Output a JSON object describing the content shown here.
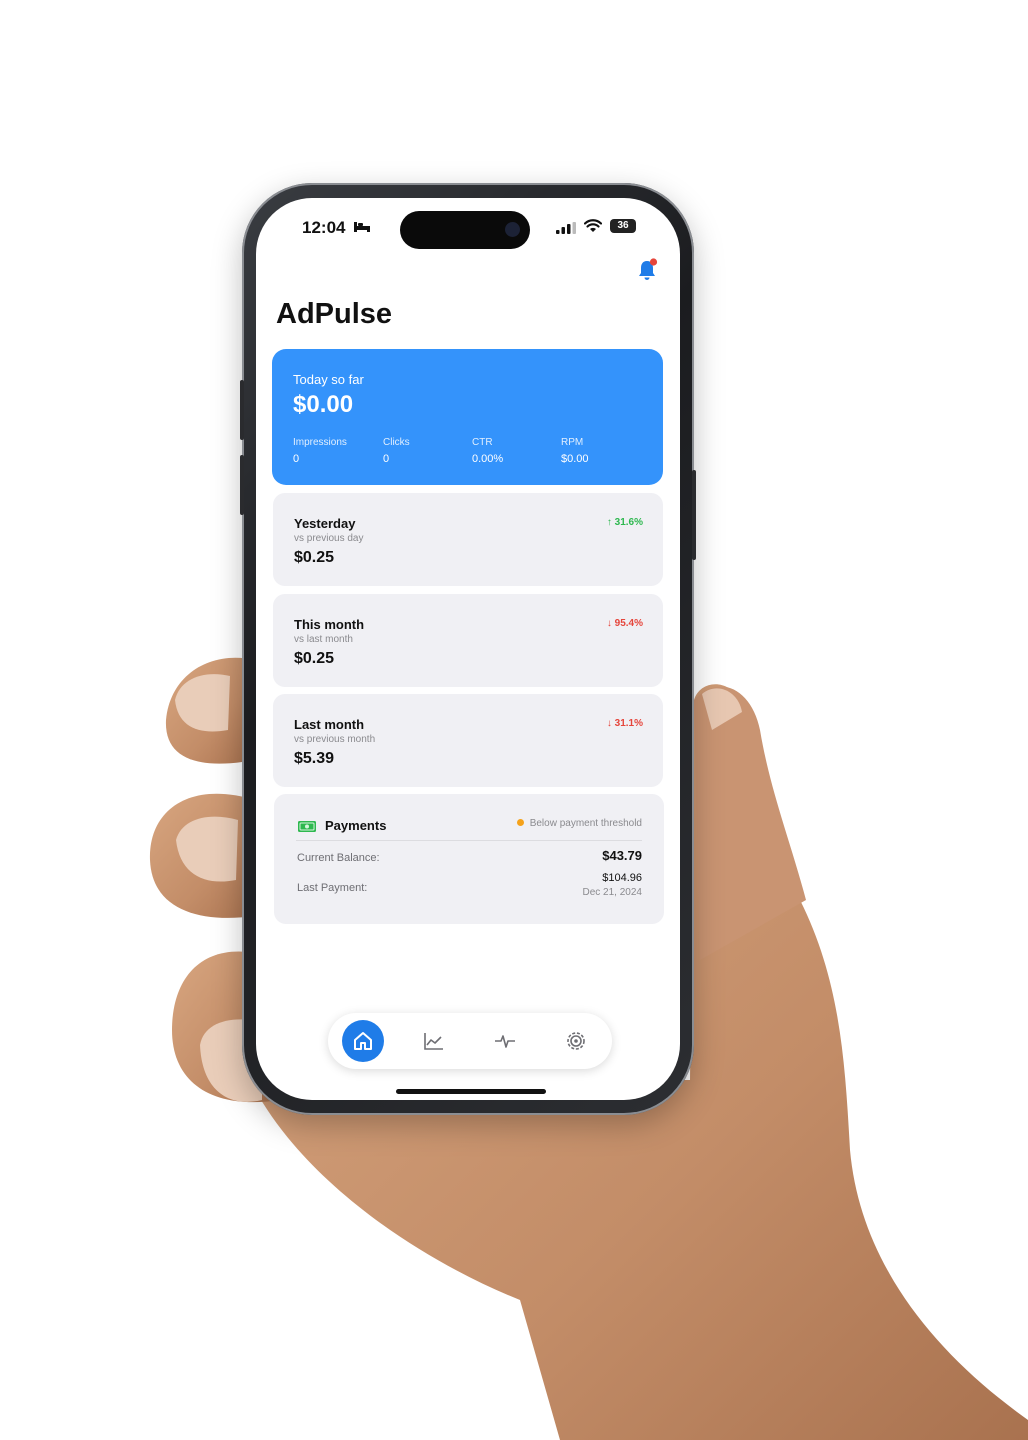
{
  "status_bar": {
    "time": "12:04",
    "battery": "36"
  },
  "app": {
    "title": "AdPulse"
  },
  "today": {
    "label": "Today so far",
    "amount": "$0.00",
    "metrics": [
      {
        "label": "Impressions",
        "value": "0"
      },
      {
        "label": "Clicks",
        "value": "0"
      },
      {
        "label": "CTR",
        "value": "0.00%"
      },
      {
        "label": "RPM",
        "value": "$0.00"
      }
    ]
  },
  "stats": [
    {
      "title": "Yesterday",
      "subtitle": "vs previous day",
      "value": "$0.25",
      "change": "↑ 31.6%",
      "direction": "up"
    },
    {
      "title": "This month",
      "subtitle": "vs last month",
      "value": "$0.25",
      "change": "↓ 95.4%",
      "direction": "down"
    },
    {
      "title": "Last month",
      "subtitle": "vs previous month",
      "value": "$5.39",
      "change": "↓ 31.1%",
      "direction": "down"
    }
  ],
  "payments": {
    "title": "Payments",
    "status": "Below payment threshold",
    "current_balance_label": "Current Balance:",
    "current_balance": "$43.79",
    "last_payment_label": "Last Payment:",
    "last_payment_amount": "$104.96",
    "last_payment_date": "Dec 21, 2024"
  },
  "tabs": [
    {
      "icon": "home-icon",
      "active": true
    },
    {
      "icon": "chart-icon",
      "active": false
    },
    {
      "icon": "pulse-icon",
      "active": false
    },
    {
      "icon": "settings-icon",
      "active": false
    }
  ],
  "colors": {
    "accent": "#3493fb",
    "up": "#2eb84f",
    "down": "#e5453b",
    "threshold_dot": "#f5a21a"
  }
}
